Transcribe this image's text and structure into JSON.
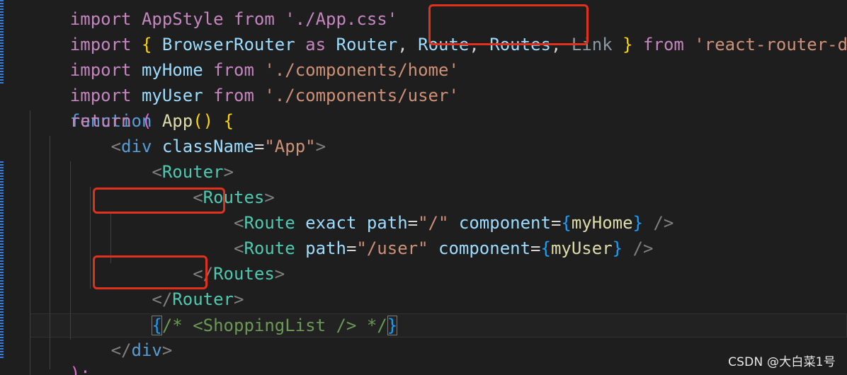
{
  "editor": {
    "lines": {
      "top_partial": "import AppStyle from './App.css'",
      "l1": {
        "kw_import": "import",
        "open_brace": "{",
        "browser_router": "BrowserRouter",
        "as": "as",
        "router": "Router",
        "comma1": ",",
        "route": "Route",
        "comma2": ",",
        "routes": "Routes",
        "comma3": ",",
        "link": "Link",
        "close_brace": "}",
        "from": "from",
        "source": "'react-router-dom'",
        "semicolon": ";"
      },
      "l2": {
        "kw": "import",
        "name": "myHome",
        "from": "from",
        "source": "'./components/home'"
      },
      "l3": {
        "kw": "import",
        "name": "myUser",
        "from": "from",
        "source": "'./components/user'"
      },
      "l4": {
        "kw": "function",
        "name": "App",
        "parens": "()",
        "brace": "{"
      },
      "l5": {
        "kw": "return",
        "paren": "("
      },
      "l6": {
        "lt": "<",
        "tag": "div",
        "attr": "className",
        "eq": "=",
        "value": "\"App\"",
        "gt": ">"
      },
      "l7": {
        "lt": "<",
        "tag": "Router",
        "gt": ">"
      },
      "l8": {
        "lt": "<",
        "tag": "Routes",
        "gt": ">"
      },
      "l9": {
        "lt": "<",
        "tag": "Route",
        "attr1": "exact",
        "attr2": "path",
        "eq": "=",
        "value": "\"/\"",
        "attr3": "component",
        "eq2": "=",
        "ob": "{",
        "expr": "myHome",
        "cb": "}",
        "close": "/>"
      },
      "l10": {
        "lt": "<",
        "tag": "Route",
        "attr2": "path",
        "eq": "=",
        "value": "\"/user\"",
        "attr3": "component",
        "eq2": "=",
        "ob": "{",
        "expr": "myUser",
        "cb": "}",
        "close": "/>"
      },
      "l11": {
        "lt": "</",
        "tag": "Routes",
        "gt": ">"
      },
      "l12": {
        "lt": "</",
        "tag": "Router",
        "gt": ">"
      },
      "l13": {
        "ob": "{",
        "comment": "/* <ShoppingList /> */",
        "cb": "}"
      },
      "l14": {
        "lt": "</",
        "tag": "div",
        "gt": ">"
      },
      "l15": {
        "text": ");"
      }
    }
  },
  "watermark": "CSDN @大白菜1号",
  "colors": {
    "background": "#1e1e1e",
    "annotation_box": "#e0301e",
    "keyword": "#c586c0",
    "storage_keyword": "#569cd6",
    "function": "#dcdcaa",
    "variable": "#9cdcfe",
    "string": "#ce9178",
    "jsx_tag": "#4ec9b0"
  }
}
